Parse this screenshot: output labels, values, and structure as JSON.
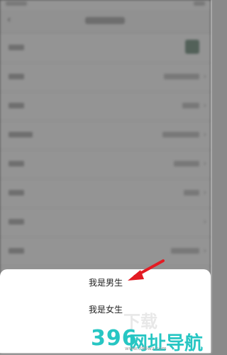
{
  "sheet": {
    "options": [
      "我是男生",
      "我是女生"
    ]
  },
  "watermark": {
    "top_text": "下载",
    "main_num": "396",
    "main_cn": "网址导航",
    "url": "www.396wz.com"
  },
  "colors": {
    "overlay": "rgba(0,0,0,0.42)",
    "arrow": "#e31b23",
    "watermark_accent": "#27c6c3"
  }
}
